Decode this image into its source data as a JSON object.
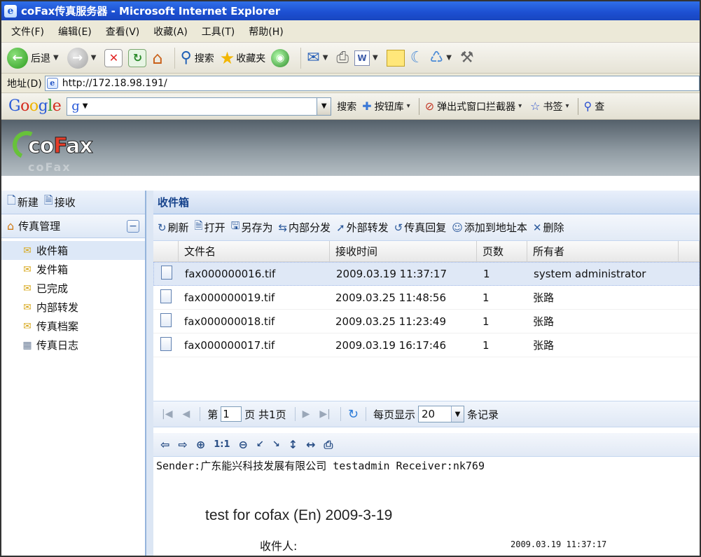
{
  "window": {
    "title": "coFax传真服务器 - Microsoft Internet Explorer"
  },
  "menu": [
    "文件(F)",
    "编辑(E)",
    "查看(V)",
    "收藏(A)",
    "工具(T)",
    "帮助(H)"
  ],
  "toolbar": {
    "back": "后退",
    "search": "搜索",
    "favorites": "收藏夹"
  },
  "address": {
    "label": "地址(D)",
    "url": "http://172.18.98.191/"
  },
  "google": {
    "search_label": "搜索",
    "buttons": "按钮库",
    "popup_blocker": "弹出式窗口拦截器",
    "bookmarks": "书签",
    "more": "查"
  },
  "sidebar": {
    "new": "新建",
    "receive": "接收",
    "section": "传真管理",
    "items": [
      {
        "label": "收件箱"
      },
      {
        "label": "发件箱"
      },
      {
        "label": "已完成"
      },
      {
        "label": "内部转发"
      },
      {
        "label": "传真档案"
      },
      {
        "label": "传真日志"
      }
    ]
  },
  "panel": {
    "title": "收件箱"
  },
  "actions": [
    "刷新",
    "打开",
    "另存为",
    "内部分发",
    "外部转发",
    "传真回复",
    "添加到地址本",
    "删除"
  ],
  "table": {
    "columns": [
      "文件名",
      "接收时间",
      "页数",
      "所有者"
    ],
    "rows": [
      {
        "file": "fax000000016.tif",
        "time": "2009.03.19 11:37:17",
        "pages": "1",
        "owner": "system administrator"
      },
      {
        "file": "fax000000019.tif",
        "time": "2009.03.25 11:48:56",
        "pages": "1",
        "owner": "张路"
      },
      {
        "file": "fax000000018.tif",
        "time": "2009.03.25 11:23:49",
        "pages": "1",
        "owner": "张路"
      },
      {
        "file": "fax000000017.tif",
        "time": "2009.03.19 16:17:46",
        "pages": "1",
        "owner": "张路"
      }
    ]
  },
  "pager": {
    "page_prefix": "第",
    "page": "1",
    "page_suffix": "页 共1页",
    "per_page_label": "每页显示",
    "per_page": "20",
    "records": "条记录"
  },
  "fax": {
    "header": "Sender:广东能兴科技发展有限公司 testadmin  Receiver:nk769",
    "title": "test for cofax (En) 2009-3-19",
    "recipient": "收件人:",
    "stamp": "2009.03.19 11:37:17"
  }
}
